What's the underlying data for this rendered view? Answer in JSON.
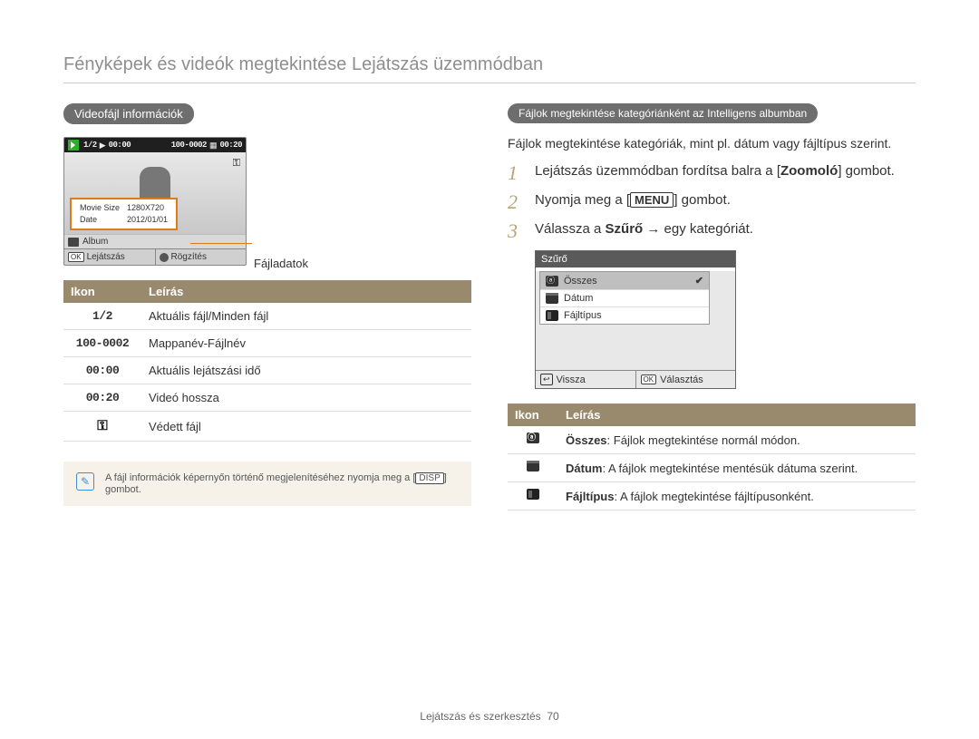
{
  "page_title": "Fényképek és videók megtekintése Lejátszás üzemmódban",
  "left": {
    "section": "Videofájl információk",
    "player": {
      "counter": "1/2",
      "elapsed": "00:00",
      "file_no": "100-0002",
      "total": "00:20",
      "info_rows": [
        {
          "k": "Movie Size",
          "v": "1280X720"
        },
        {
          "k": "Date",
          "v": "2012/01/01"
        }
      ],
      "album": "Album",
      "play_label": "Lejátszás",
      "capture_label": "Rögzítés"
    },
    "callout": "Fájladatok",
    "table": {
      "head": {
        "icon": "Ikon",
        "desc": "Leírás"
      },
      "rows": [
        {
          "icon_text": "1/2",
          "icon_class": "lcd",
          "desc": "Aktuális fájl/Minden fájl"
        },
        {
          "icon_text": "100-0002",
          "icon_class": "lcd",
          "desc": "Mappanév-Fájlnév"
        },
        {
          "icon_text": "00:00",
          "icon_class": "lcd",
          "desc": "Aktuális lejátszási idő"
        },
        {
          "icon_text": "00:20",
          "icon_class": "lcd",
          "desc": "Videó hossza"
        },
        {
          "icon_text": "⚿",
          "icon_class": "key-icon",
          "desc": "Védett fájl"
        }
      ]
    },
    "note_pre": "A fájl információk képernyőn történő megjelenítéséhez nyomja meg a [",
    "note_btn": "DISP",
    "note_post": "] gombot."
  },
  "right": {
    "section": "Fájlok megtekintése kategóriánként az Intelligens albumban",
    "intro": "Fájlok megtekintése kategóriák, mint pl. dátum vagy fájltípus szerint.",
    "steps": [
      {
        "pre": "Lejátszás üzemmódban fordítsa balra a [",
        "bold": "Zoomoló",
        "post": "] gombot."
      },
      {
        "pre": "Nyomja meg a [",
        "btn": "MENU",
        "post": "] gombot."
      },
      {
        "pre": "Válassza a ",
        "bold": "Szűrő",
        "post": " → egy kategóriát."
      }
    ],
    "filter_panel": {
      "title": "Szűrő",
      "items": [
        {
          "icon": "all",
          "label": "Összes",
          "selected": true
        },
        {
          "icon": "cal",
          "label": "Dátum",
          "selected": false
        },
        {
          "icon": "ft",
          "label": "Fájltípus",
          "selected": false
        }
      ],
      "back": "Vissza",
      "ok": "OK",
      "select": "Választás"
    },
    "table": {
      "head": {
        "icon": "Ikon",
        "desc": "Leírás"
      },
      "rows": [
        {
          "icon": "all",
          "bold": "Összes",
          "desc": ": Fájlok megtekintése normál módon."
        },
        {
          "icon": "cal",
          "bold": "Dátum",
          "desc": ": A fájlok megtekintése mentésük dátuma szerint."
        },
        {
          "icon": "ft",
          "bold": "Fájltípus",
          "desc": ": A fájlok megtekintése fájltípusonként."
        }
      ]
    }
  },
  "footer": {
    "section": "Lejátszás és szerkesztés",
    "page": "70"
  }
}
